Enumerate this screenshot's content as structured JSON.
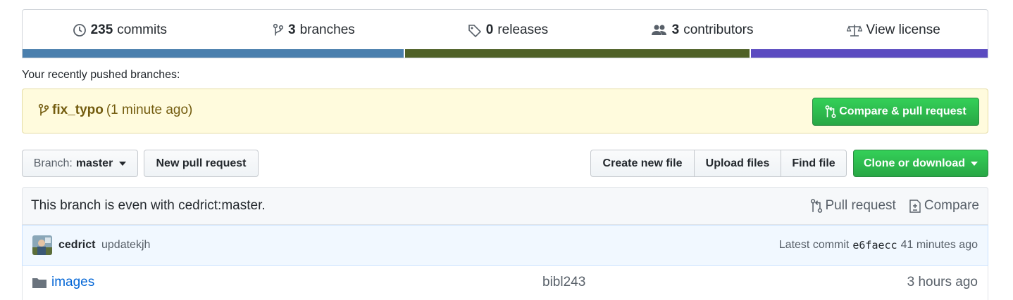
{
  "summary": {
    "commits": {
      "num": "235",
      "label": "commits",
      "icon": "history-icon"
    },
    "branches": {
      "num": "3",
      "label": "branches",
      "icon": "git-branch-icon"
    },
    "releases": {
      "num": "0",
      "label": "releases",
      "icon": "tag-icon"
    },
    "contributors": {
      "num": "3",
      "label": "contributors",
      "icon": "people-icon"
    },
    "license": {
      "label": "View license",
      "icon": "law-icon"
    }
  },
  "language_bar": [
    {
      "color": "#4a7fad",
      "share": 0.395
    },
    {
      "color": "#4f6127",
      "share": 0.358
    },
    {
      "color": "#5b4bc0",
      "share": 0.247
    }
  ],
  "recent": {
    "title": "Your recently pushed branches:",
    "branch_name": "fix_typo",
    "time": "(1 minute ago)",
    "compare_button": "Compare & pull request"
  },
  "toolbar": {
    "branch_prefix": "Branch:",
    "branch_name": "master",
    "new_pr": "New pull request",
    "create_file": "Create new file",
    "upload_files": "Upload files",
    "find_file": "Find file",
    "clone": "Clone or download"
  },
  "branch_status": {
    "text": "This branch is even with cedrict:master.",
    "pull_request": "Pull request",
    "compare": "Compare"
  },
  "latest_commit": {
    "author": "cedrict",
    "message": "updatekjh",
    "prefix": "Latest commit",
    "sha": "e6faecc",
    "age": "41 minutes ago"
  },
  "files": [
    {
      "name": "images",
      "message": "bibl243",
      "age": "3 hours ago",
      "icon": "folder-icon"
    }
  ],
  "colors": {
    "link": "#0366d6",
    "green": "#28a745",
    "banner": "#fffbdd",
    "commit_bg": "#f1f8ff"
  }
}
